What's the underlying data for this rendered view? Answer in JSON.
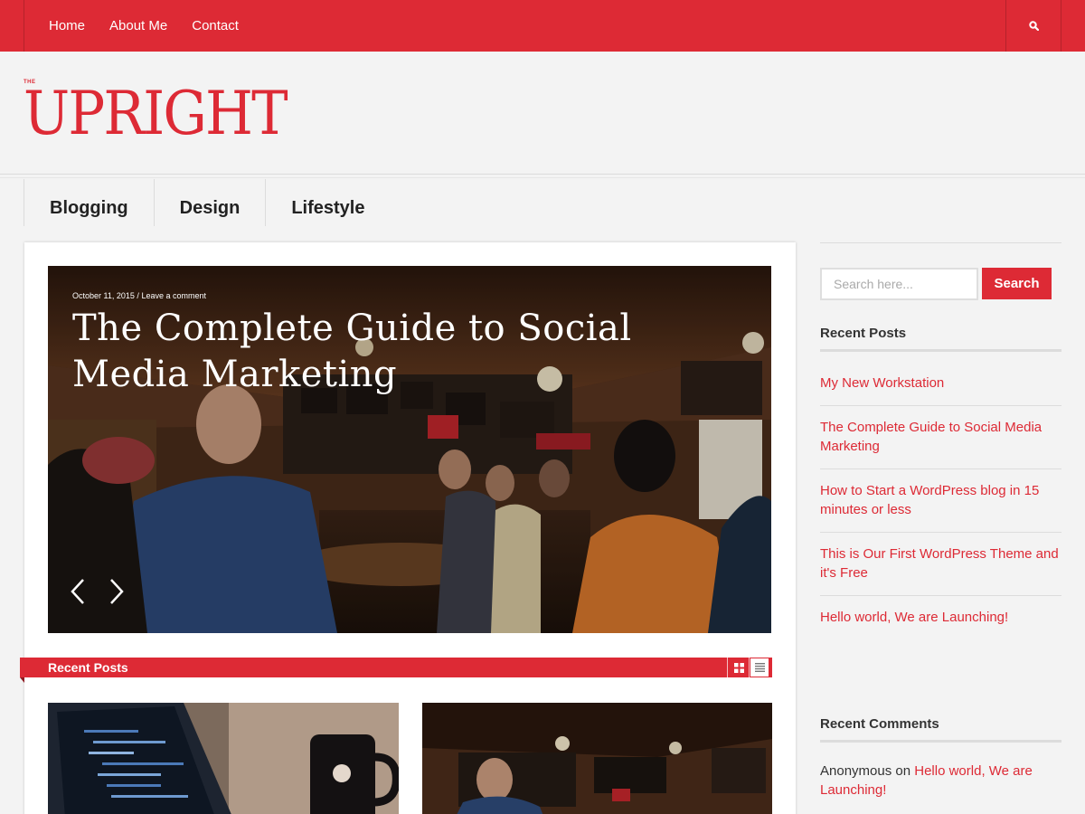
{
  "topnav": {
    "items": [
      {
        "label": "Home"
      },
      {
        "label": "About Me"
      },
      {
        "label": "Contact"
      }
    ],
    "search_icon": "search-icon"
  },
  "logo": {
    "small": "THE",
    "main": "UPRIGHT"
  },
  "categories": [
    {
      "label": "Blogging"
    },
    {
      "label": "Design"
    },
    {
      "label": "Lifestyle"
    }
  ],
  "slider": {
    "date": "October 11, 2015",
    "separator": "/",
    "comment_link": "Leave a comment",
    "title": "The Complete Guide to Social Media Marketing",
    "prev_icon": "chevron-left-icon",
    "next_icon": "chevron-right-icon"
  },
  "recent_posts_bar": {
    "label": "Recent Posts",
    "grid_icon": "grid-view-icon",
    "list_icon": "list-view-icon"
  },
  "sidebar": {
    "search": {
      "placeholder": "Search here...",
      "button": "Search"
    },
    "recent_posts": {
      "title": "Recent Posts",
      "items": [
        {
          "label": "My New Workstation"
        },
        {
          "label": "The Complete Guide to Social Media Marketing"
        },
        {
          "label": "How to Start a WordPress blog in 15 minutes or less"
        },
        {
          "label": "This is Our First WordPress Theme and it's Free"
        },
        {
          "label": "Hello world, We are Launching!"
        }
      ]
    },
    "recent_comments": {
      "title": "Recent Comments",
      "author": "Anonymous",
      "on": "on",
      "post": "Hello world, We are Launching!"
    }
  },
  "colors": {
    "accent": "#dd2a35",
    "background": "#f3f3f3"
  }
}
